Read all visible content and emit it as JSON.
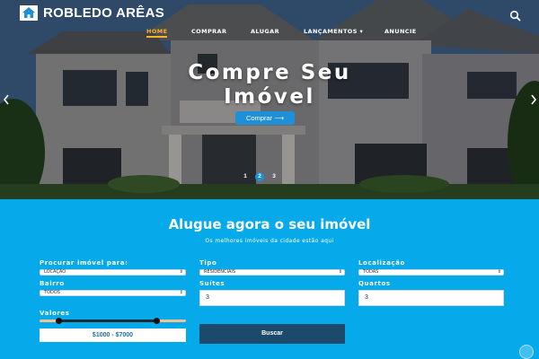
{
  "brand": {
    "name": "ROBLEDO ARÊAS",
    "icon": "home-icon"
  },
  "nav": {
    "items": [
      {
        "label": "HOME",
        "active": true
      },
      {
        "label": "COMPRAR",
        "active": false
      },
      {
        "label": "ALUGAR",
        "active": false
      },
      {
        "label": "LANÇAMENTOS ▾",
        "active": false
      },
      {
        "label": "ANUNCIE",
        "active": false
      }
    ],
    "search_icon": "search-icon"
  },
  "hero": {
    "title_line1": "Compre Seu",
    "title_line2": "Imóvel",
    "button_label": "Comprar ⟶",
    "slides": [
      "1",
      "2",
      "3"
    ],
    "active_slide": "2"
  },
  "search": {
    "title": "Alugue agora o seu imóvel",
    "subtitle": "Os melhores imóveis da cidade estão aqui",
    "purpose_label": "Procurar imóvel para:",
    "purpose_value": "LOCAÇÃO",
    "type_label": "Tipo",
    "type_value": "RESIDENCIAIS",
    "location_label": "Localização",
    "location_value": "TODAS",
    "district_label": "Bairro",
    "district_value": "TODOS",
    "suites_label": "Suítes",
    "suites_value": "3",
    "rooms_label": "Quartos",
    "rooms_value": "3",
    "price_label": "Valores",
    "price_range": "$1000 - $7000",
    "search_button": "Buscar"
  },
  "colors": {
    "accent": "#f7b32b",
    "section_bg": "#06a9ea",
    "button_dark": "#1b4a6b",
    "hero_button": "#1f8fd8"
  }
}
